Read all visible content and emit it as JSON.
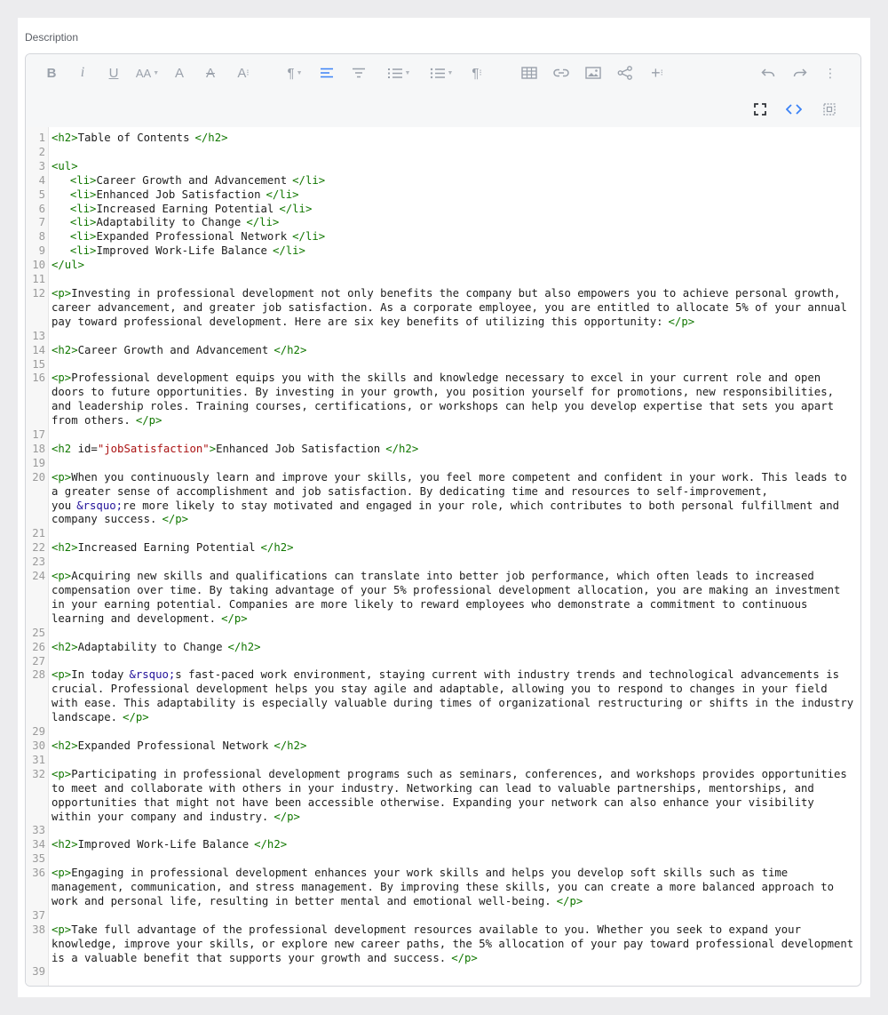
{
  "field": {
    "label": "Description"
  },
  "toolbar": {
    "buttons": [
      {
        "name": "bold",
        "glyph": "B"
      },
      {
        "name": "italic",
        "glyph": "i"
      },
      {
        "name": "underline",
        "glyph": "U"
      },
      {
        "name": "font-size",
        "glyph": "AA"
      },
      {
        "name": "text-color",
        "glyph": "A"
      },
      {
        "name": "clear-format",
        "glyph": "A"
      },
      {
        "name": "text-style",
        "glyph": "A"
      }
    ]
  },
  "colors": {
    "accent": "#3b82f6",
    "tag": "#117700",
    "string": "#aa1111",
    "entity": "#221199",
    "line_number": "#9a9a9a"
  },
  "code": [
    [
      {
        "t": "tag",
        "v": "<h2>"
      },
      {
        "t": "txt",
        "v": "Table of Contents"
      },
      {
        "t": "tag",
        "v": "</h2>"
      }
    ],
    [],
    [
      {
        "t": "tag",
        "v": "<ul>"
      }
    ],
    [
      {
        "t": "txt",
        "v": "  "
      },
      {
        "t": "tag",
        "v": "<li>"
      },
      {
        "t": "txt",
        "v": "Career Growth and Advancement"
      },
      {
        "t": "tag",
        "v": "</li>"
      }
    ],
    [
      {
        "t": "txt",
        "v": "  "
      },
      {
        "t": "tag",
        "v": "<li>"
      },
      {
        "t": "txt",
        "v": "Enhanced Job Satisfaction"
      },
      {
        "t": "tag",
        "v": "</li>"
      }
    ],
    [
      {
        "t": "txt",
        "v": "  "
      },
      {
        "t": "tag",
        "v": "<li>"
      },
      {
        "t": "txt",
        "v": "Increased Earning Potential"
      },
      {
        "t": "tag",
        "v": "</li>"
      }
    ],
    [
      {
        "t": "txt",
        "v": "  "
      },
      {
        "t": "tag",
        "v": "<li>"
      },
      {
        "t": "txt",
        "v": "Adaptability to Change"
      },
      {
        "t": "tag",
        "v": "</li>"
      }
    ],
    [
      {
        "t": "txt",
        "v": "  "
      },
      {
        "t": "tag",
        "v": "<li>"
      },
      {
        "t": "txt",
        "v": "Expanded Professional Network"
      },
      {
        "t": "tag",
        "v": "</li>"
      }
    ],
    [
      {
        "t": "txt",
        "v": "  "
      },
      {
        "t": "tag",
        "v": "<li>"
      },
      {
        "t": "txt",
        "v": "Improved Work-Life Balance"
      },
      {
        "t": "tag",
        "v": "</li>"
      }
    ],
    [
      {
        "t": "tag",
        "v": "</ul>"
      }
    ],
    [],
    [
      {
        "t": "tag",
        "v": "<p>"
      },
      {
        "t": "txt",
        "v": "Investing in professional development not only benefits the company but also empowers you to achieve personal growth, career advancement, and greater job satisfaction. As a corporate employee, you are entitled to allocate 5% of your annual pay toward professional development. Here are six key benefits of utilizing this opportunity:"
      },
      {
        "t": "tag",
        "v": "</p>"
      }
    ],
    [],
    [
      {
        "t": "tag",
        "v": "<h2>"
      },
      {
        "t": "txt",
        "v": "Career Growth and Advancement"
      },
      {
        "t": "tag",
        "v": "</h2>"
      }
    ],
    [],
    [
      {
        "t": "tag",
        "v": "<p>"
      },
      {
        "t": "txt",
        "v": "Professional development equips you with the skills and knowledge necessary to excel in your current role and open doors to future opportunities. By investing in your growth, you position yourself for promotions, new responsibilities, and leadership roles. Training courses, certifications, or workshops can help you develop expertise that sets you apart from others."
      },
      {
        "t": "tag",
        "v": "</p>"
      }
    ],
    [],
    [
      {
        "t": "tag",
        "v": "<h2 "
      },
      {
        "t": "attr",
        "v": "id="
      },
      {
        "t": "str",
        "v": "\"jobSatisfaction\""
      },
      {
        "t": "tag",
        "v": ">"
      },
      {
        "t": "txt",
        "v": "Enhanced Job Satisfaction"
      },
      {
        "t": "tag",
        "v": "</h2>"
      }
    ],
    [],
    [
      {
        "t": "tag",
        "v": "<p>"
      },
      {
        "t": "txt",
        "v": "When you continuously learn and improve your skills, you feel more competent and confident in your work. This leads to a greater sense of accomplishment and job satisfaction. By dedicating time and resources to self-improvement, you"
      },
      {
        "t": "ent",
        "v": "&rsquo;"
      },
      {
        "t": "txt",
        "v": "re more likely to stay motivated and engaged in your role, which contributes to both personal fulfillment and company success."
      },
      {
        "t": "tag",
        "v": "</p>"
      }
    ],
    [],
    [
      {
        "t": "tag",
        "v": "<h2>"
      },
      {
        "t": "txt",
        "v": "Increased Earning Potential"
      },
      {
        "t": "tag",
        "v": "</h2>"
      }
    ],
    [],
    [
      {
        "t": "tag",
        "v": "<p>"
      },
      {
        "t": "txt",
        "v": "Acquiring new skills and qualifications can translate into better job performance, which often leads to increased compensation over time. By taking advantage of your 5% professional development allocation, you are making an investment in your earning potential. Companies are more likely to reward employees who demonstrate a commitment to continuous learning and development."
      },
      {
        "t": "tag",
        "v": "</p>"
      }
    ],
    [],
    [
      {
        "t": "tag",
        "v": "<h2>"
      },
      {
        "t": "txt",
        "v": "Adaptability to Change"
      },
      {
        "t": "tag",
        "v": "</h2>"
      }
    ],
    [],
    [
      {
        "t": "tag",
        "v": "<p>"
      },
      {
        "t": "txt",
        "v": "In today"
      },
      {
        "t": "ent",
        "v": "&rsquo;"
      },
      {
        "t": "txt",
        "v": "s fast-paced work environment, staying current with industry trends and technological advancements is crucial. Professional development helps you stay agile and adaptable, allowing you to respond to changes in your field with ease. This adaptability is especially valuable during times of organizational restructuring or shifts in the industry landscape."
      },
      {
        "t": "tag",
        "v": "</p>"
      }
    ],
    [],
    [
      {
        "t": "tag",
        "v": "<h2>"
      },
      {
        "t": "txt",
        "v": "Expanded Professional Network"
      },
      {
        "t": "tag",
        "v": "</h2>"
      }
    ],
    [],
    [
      {
        "t": "tag",
        "v": "<p>"
      },
      {
        "t": "txt",
        "v": "Participating in professional development programs such as seminars, conferences, and workshops provides opportunities to meet and collaborate with others in your industry. Networking can lead to valuable partnerships, mentorships, and opportunities that might not have been accessible otherwise. Expanding your network can also enhance your visibility within your company and industry."
      },
      {
        "t": "tag",
        "v": "</p>"
      }
    ],
    [],
    [
      {
        "t": "tag",
        "v": "<h2>"
      },
      {
        "t": "txt",
        "v": "Improved Work-Life Balance"
      },
      {
        "t": "tag",
        "v": "</h2>"
      }
    ],
    [],
    [
      {
        "t": "tag",
        "v": "<p>"
      },
      {
        "t": "txt",
        "v": "Engaging in professional development enhances your work skills and helps you develop soft skills such as time management, communication, and stress management. By improving these skills, you can create a more balanced approach to work and personal life, resulting in better mental and emotional well-being."
      },
      {
        "t": "tag",
        "v": "</p>"
      }
    ],
    [],
    [
      {
        "t": "tag",
        "v": "<p>"
      },
      {
        "t": "txt",
        "v": "Take full advantage of the professional development resources available to you. Whether you seek to expand your knowledge, improve your skills, or explore new career paths, the 5% allocation of your pay toward professional development is a valuable benefit that supports your growth and success."
      },
      {
        "t": "tag",
        "v": "</p>"
      }
    ],
    []
  ]
}
